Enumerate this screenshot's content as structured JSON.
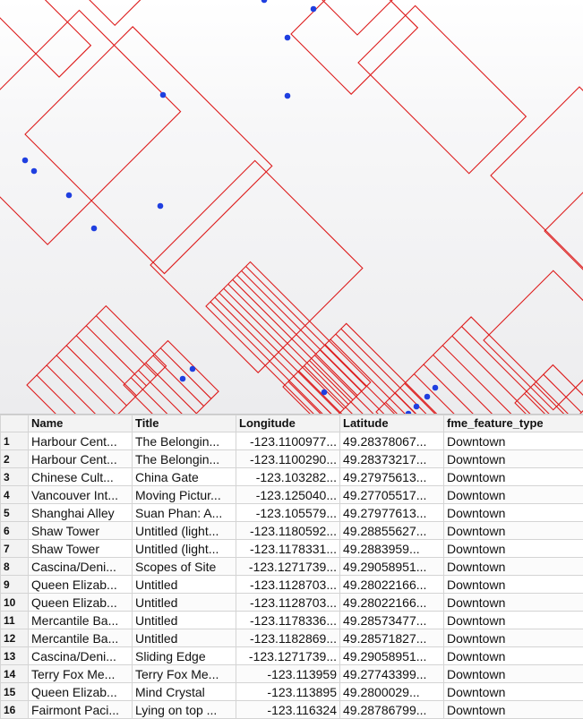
{
  "map": {
    "parcel_stroke_color": "#dd1c1c",
    "point_color": "#1f3fe0"
  },
  "table": {
    "columns": [
      "",
      "Name",
      "Title",
      "Longitude",
      "Latitude",
      "fme_feature_type"
    ],
    "rows": [
      [
        "1",
        "Harbour Cent...",
        "The Belongin...",
        "-123.1100977...",
        "49.28378067...",
        "Downtown"
      ],
      [
        "2",
        "Harbour Cent...",
        "The Belongin...",
        "-123.1100290...",
        "49.28373217...",
        "Downtown"
      ],
      [
        "3",
        "Chinese Cult...",
        "China Gate",
        "-123.103282...",
        "49.27975613...",
        "Downtown"
      ],
      [
        "4",
        "Vancouver Int...",
        "Moving Pictur...",
        "-123.125040...",
        "49.27705517...",
        "Downtown"
      ],
      [
        "5",
        "Shanghai Alley",
        "Suan Phan: A...",
        "-123.105579...",
        "49.27977613...",
        "Downtown"
      ],
      [
        "6",
        "Shaw Tower",
        "Untitled (light...",
        "-123.1180592...",
        "49.28855627...",
        "Downtown"
      ],
      [
        "7",
        "Shaw Tower",
        "Untitled (light...",
        "-123.1178331...",
        "49.2883959...",
        "Downtown"
      ],
      [
        "8",
        "Cascina/Deni...",
        "Scopes of Site",
        "-123.1271739...",
        "49.29058951...",
        "Downtown"
      ],
      [
        "9",
        "Queen Elizab...",
        "Untitled",
        "-123.1128703...",
        "49.28022166...",
        "Downtown"
      ],
      [
        "10",
        "Queen Elizab...",
        "Untitled",
        "-123.1128703...",
        "49.28022166...",
        "Downtown"
      ],
      [
        "11",
        "Mercantile Ba...",
        "Untitled",
        "-123.1178336...",
        "49.28573477...",
        "Downtown"
      ],
      [
        "12",
        "Mercantile Ba...",
        "Untitled",
        "-123.1182869...",
        "49.28571827...",
        "Downtown"
      ],
      [
        "13",
        "Cascina/Deni...",
        "Sliding Edge",
        "-123.1271739...",
        "49.29058951...",
        "Downtown"
      ],
      [
        "14",
        "Terry Fox Me...",
        "Terry Fox Me...",
        "-123.113959",
        "49.27743399...",
        "Downtown"
      ],
      [
        "15",
        "Queen Elizab...",
        "Mind Crystal",
        "-123.113895",
        "49.2800029...",
        "Downtown"
      ],
      [
        "16",
        "Fairmont Paci...",
        "Lying on top ...",
        "-123.116324",
        "49.28786799...",
        "Downtown"
      ]
    ]
  }
}
